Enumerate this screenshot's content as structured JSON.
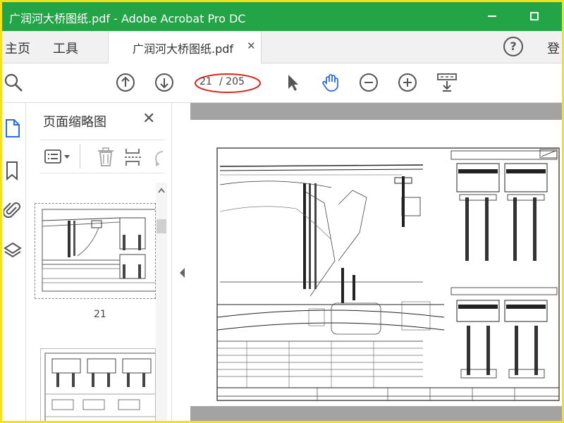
{
  "window": {
    "title": "广润河大桥图纸.pdf - Adobe Acrobat Pro DC"
  },
  "menu": {
    "home": "主页",
    "tools": "工具",
    "login": "登"
  },
  "tab": {
    "label": "广润河大桥图纸.pdf",
    "close": "✕"
  },
  "toolbar": {
    "current_page": "21",
    "total_pages": "/ 205"
  },
  "panel": {
    "title": "页面缩略图",
    "close": "✕",
    "thumb_label": "21"
  },
  "colors": {
    "titlebar": "#22a447",
    "highlight_ellipse": "#d9261c",
    "frame": "#f4e21a",
    "active_icon": "#2d6cdf"
  }
}
